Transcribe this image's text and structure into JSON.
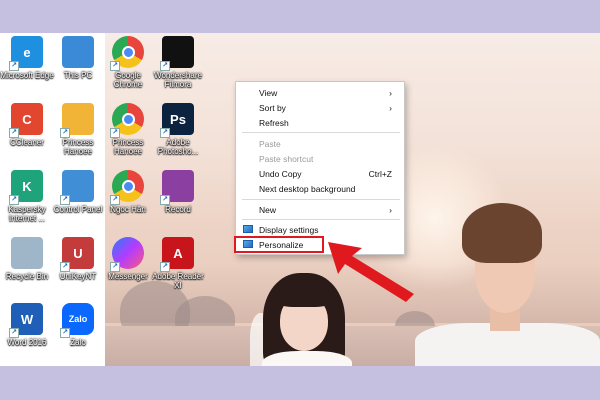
{
  "desktop": {
    "icons": [
      {
        "label": "Microsoft Edge",
        "glyph": "e",
        "color": "#1f8fe0"
      },
      {
        "label": "This PC",
        "glyph": "",
        "color": "#3a8ad8"
      },
      {
        "label": "Google Chrome",
        "glyph": "",
        "color": "#e8453c"
      },
      {
        "label": "Wondershare Filmora",
        "glyph": "",
        "color": "#111111"
      },
      {
        "label": "CCleaner",
        "glyph": "C",
        "color": "#e2462f"
      },
      {
        "label": "Princess Hanoee",
        "glyph": "",
        "color": "#f2b437"
      },
      {
        "label": "Princess Hanoee",
        "glyph": "",
        "color": "#e8453c"
      },
      {
        "label": "Adobe Photosho...",
        "glyph": "Ps",
        "color": "#0c2340"
      },
      {
        "label": "Kaspersky Internet ...",
        "glyph": "K",
        "color": "#1fa37a"
      },
      {
        "label": "Control Panel",
        "glyph": "",
        "color": "#3f8ed6"
      },
      {
        "label": "Ngoc Hân",
        "glyph": "",
        "color": "#e8453c"
      },
      {
        "label": "Record",
        "glyph": "",
        "color": "#8b3fa0"
      },
      {
        "label": "Recycle Bin",
        "glyph": "",
        "color": "#9fb6c8"
      },
      {
        "label": "UniKeyNT",
        "glyph": "U",
        "color": "#c33b3b"
      },
      {
        "label": "Messenger",
        "glyph": "",
        "color": "#8c4dff"
      },
      {
        "label": "Adobe Reader XI",
        "glyph": "A",
        "color": "#c8141b"
      },
      {
        "label": "Word 2016",
        "glyph": "W",
        "color": "#1f5fb7"
      },
      {
        "label": "Zalo",
        "glyph": "Zalo",
        "color": "#0a68ff"
      }
    ]
  },
  "context_menu": {
    "items": [
      {
        "label": "View",
        "shortcut": "›",
        "disabled": false
      },
      {
        "label": "Sort by",
        "shortcut": "›",
        "disabled": false
      },
      {
        "label": "Refresh",
        "shortcut": "",
        "disabled": false
      },
      {
        "label": "Paste",
        "shortcut": "",
        "disabled": true
      },
      {
        "label": "Paste shortcut",
        "shortcut": "",
        "disabled": true
      },
      {
        "label": "Undo Copy",
        "shortcut": "Ctrl+Z",
        "disabled": false
      },
      {
        "label": "Next desktop background",
        "shortcut": "",
        "disabled": false
      },
      {
        "label": "New",
        "shortcut": "›",
        "disabled": false
      },
      {
        "label": "Display settings",
        "shortcut": "",
        "disabled": false
      },
      {
        "label": "Personalize",
        "shortcut": "",
        "disabled": false
      }
    ]
  },
  "colors": {
    "page_bg": "#c5bfe0",
    "highlight": "#e0191e"
  }
}
